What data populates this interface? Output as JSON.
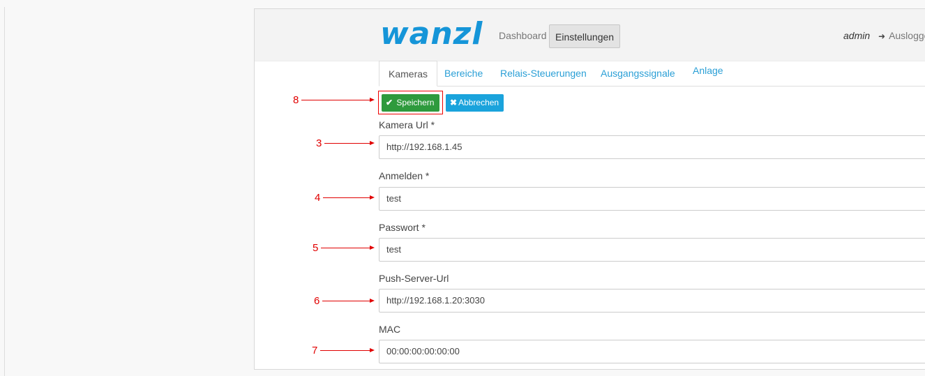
{
  "navbar": {
    "logo_text": "wanzl",
    "dashboard_label": "Dashboard",
    "settings_label": "Einstellungen",
    "user_name": "admin",
    "logout_label": "Ausloggen"
  },
  "tabs": [
    {
      "label": "Kameras",
      "active": true
    },
    {
      "label": "Bereiche",
      "active": false
    },
    {
      "label": "Relais-Steuerungen",
      "active": false
    },
    {
      "label": "Ausgangssignale",
      "active": false
    },
    {
      "label": "Anlage",
      "active": false
    }
  ],
  "actions": {
    "save_label": "Speichern",
    "cancel_label": "Abbrechen"
  },
  "form": {
    "camera_url": {
      "label": "Kamera Url *",
      "value": "http://192.168.1.45"
    },
    "login": {
      "label": "Anmelden *",
      "value": "test"
    },
    "password": {
      "label": "Passwort *",
      "value": "test"
    },
    "push_server_url": {
      "label": "Push-Server-Url",
      "value": "http://192.168.1.20:3030"
    },
    "mac": {
      "label": "MAC",
      "value": "00:00:00:00:00:00"
    }
  },
  "annotations": [
    "8",
    "3",
    "4",
    "5",
    "6",
    "7"
  ],
  "colors": {
    "brand": "#1595d8",
    "save": "#2e9a3d",
    "cancel": "#1aa3dc",
    "annotation": "#e10000",
    "tab_link": "#2a9fd6"
  }
}
